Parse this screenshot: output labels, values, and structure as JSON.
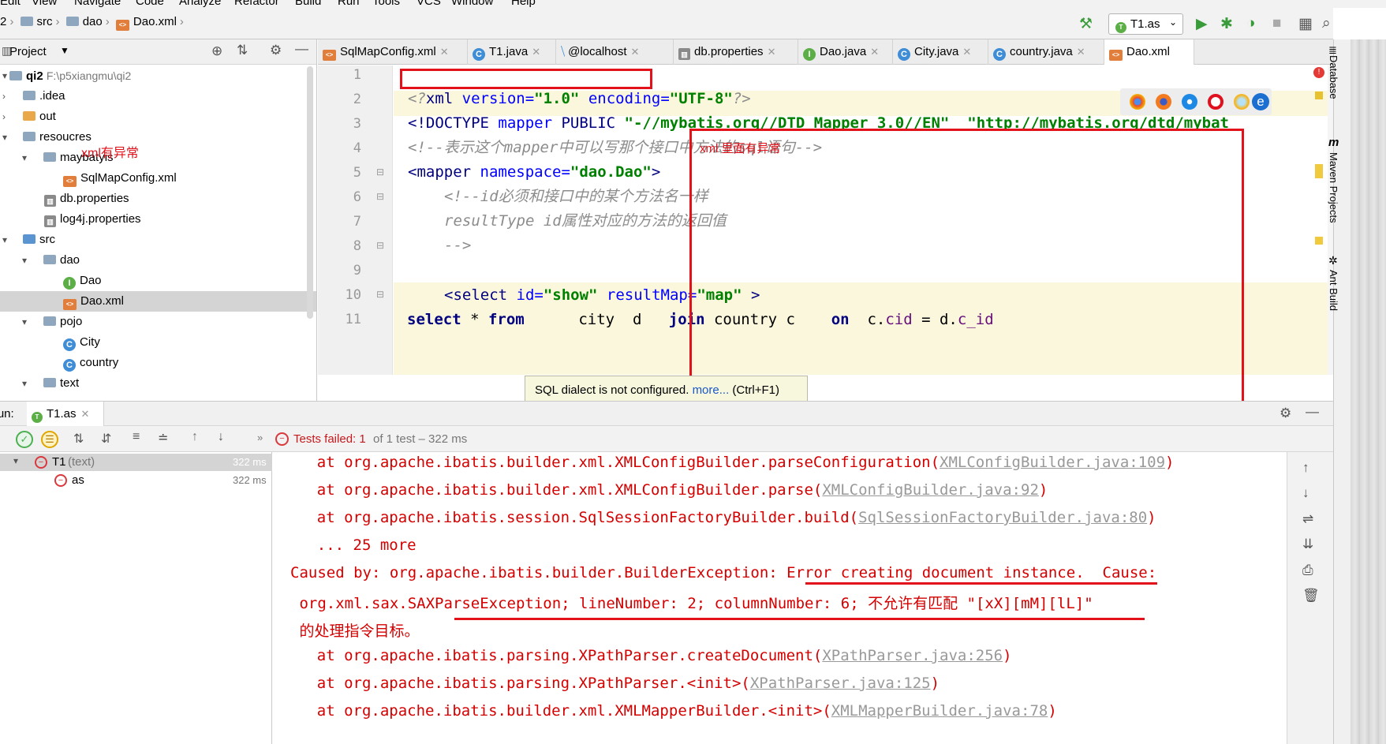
{
  "menu": [
    "Edit",
    "View",
    "Navigate",
    "Code",
    "Analyze",
    "Refactor",
    "Build",
    "Run",
    "Tools",
    "VCS",
    "Window",
    "Help"
  ],
  "breadcrumb": {
    "lead": "2",
    "items": [
      "src",
      "dao",
      "Dao.xml"
    ]
  },
  "toolbar": {
    "run_config": "T1.as"
  },
  "project": {
    "title": "Project",
    "root_name": "qi2",
    "root_path": "F:\\p5xiangmu\\qi2",
    "items": [
      ".idea",
      "out",
      "resoucres",
      "maybatyis",
      "SqlMapConfig.xml",
      "db.properties",
      "log4j.properties",
      "src",
      "dao",
      "Dao",
      "Dao.xml",
      "pojo",
      "City",
      "country",
      "text"
    ]
  },
  "tabs": [
    "SqlMapConfig.xml",
    "T1.java",
    "@localhost",
    "db.properties",
    "Dao.java",
    "City.java",
    "country.java",
    "Dao.xml"
  ],
  "editor": {
    "line_numbers": [
      "1",
      "2",
      "3",
      "4",
      "5",
      "6",
      "7",
      "8",
      "9",
      "10",
      "11"
    ],
    "l2": {
      "a": "<?",
      "b": "xml",
      "c": " version=",
      "d": "\"1.0\"",
      "e": " encoding=",
      "f": "\"UTF-8\"",
      "g": "?>"
    },
    "l3": {
      "a": "<!DOCTYPE ",
      "b": "mapper",
      "c": " PUBLIC ",
      "d": "\"-//mybatis.org//DTD Mapper 3.0//EN\"",
      "e": "  ",
      "f": "\"http://mybatis.org/dtd/mybat"
    },
    "l4": "<!--表示这个mapper中可以写那个接口中方法的sql语句-->",
    "l5": {
      "a": "<mapper ",
      "b": "namespace=",
      "c": "\"dao.Dao\"",
      "d": ">"
    },
    "l6": "<!--id必须和接口中的某个方法名一样",
    "l7": "resultType id属性对应的方法的返回值",
    "l8": "-->",
    "l10": {
      "a": "<select ",
      "b": "id=",
      "c": "\"show\"",
      "d": " resultMap=",
      "e": "\"map\"",
      "f": " >"
    },
    "l11": {
      "a": "select",
      "b": " * ",
      "c": "from",
      "d": "      city  d   ",
      "e": "join",
      "f": " country c    ",
      "g": "on",
      "h": "  c.",
      "i": "cid",
      "j": " = d.",
      "k": "c_id"
    }
  },
  "tooltip": {
    "text": "SQL dialect is not configured. ",
    "link": "more...",
    "shortcut": " (Ctrl+F1)"
  },
  "annotations": {
    "tree_note": "xml有异常",
    "editor_note": "xml 里面有异常"
  },
  "run": {
    "label": "Run:",
    "tab": "T1.as",
    "status_failed": "Tests failed: 1",
    "status_rest": " of 1 test – 322 ms",
    "tree": [
      {
        "name": "T1",
        "sub": "(text)",
        "time": "322 ms"
      },
      {
        "name": "as",
        "time": "322 ms"
      }
    ]
  },
  "console": [
    {
      "t": "    at org.apache.ibatis.builder.xml.XMLConfigBuilder.parseConfiguration(",
      "l": "XMLConfigBuilder.java:109",
      "e": ")"
    },
    {
      "t": "    at org.apache.ibatis.builder.xml.XMLConfigBuilder.parse(",
      "l": "XMLConfigBuilder.java:92",
      "e": ")"
    },
    {
      "t": "    at org.apache.ibatis.session.SqlSessionFactoryBuilder.build(",
      "l": "SqlSessionFactoryBuilder.java:80",
      "e": ")"
    },
    {
      "t": "    ... 25 more",
      "l": "",
      "e": ""
    },
    {
      "t": "Caused by: org.apache.ibatis.builder.BuilderException: Error creating document instance.  Cause:",
      "l": "",
      "e": ""
    },
    {
      "t": " org.xml.sax.SAXParseException; lineNumber: 2; columnNumber: 6; 不允许有匹配 \"[xX][mM][lL]\"",
      "l": "",
      "e": ""
    },
    {
      "t": " 的处理指令目标。",
      "l": "",
      "e": ""
    },
    {
      "t": "    at org.apache.ibatis.parsing.XPathParser.createDocument(",
      "l": "XPathParser.java:256",
      "e": ")"
    },
    {
      "t": "    at org.apache.ibatis.parsing.XPathParser.<init>(",
      "l": "XPathParser.java:125",
      "e": ")"
    },
    {
      "t": "    at org.apache.ibatis.builder.xml.XMLMapperBuilder.<init>(",
      "l": "XMLMapperBuilder.java:78",
      "e": ")"
    }
  ],
  "side_tools": [
    "Database",
    "Maven Projects",
    "Ant Build"
  ],
  "colors": {
    "accent": "#e3111a",
    "selection": "#d4d4d4",
    "error": "#d40000"
  }
}
